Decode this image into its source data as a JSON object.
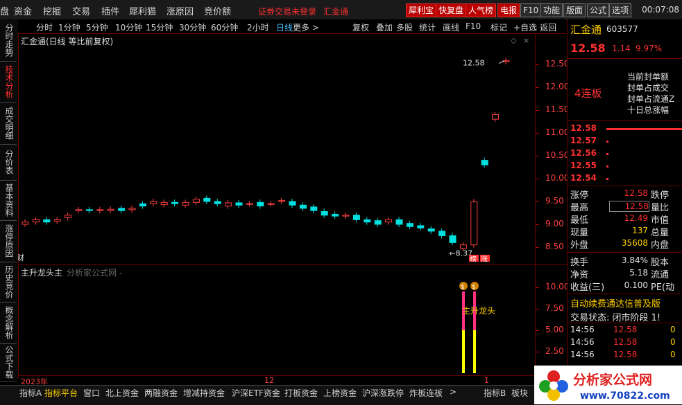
{
  "menu": {
    "items": [
      "盘",
      "资金",
      "挖掘",
      "交易",
      "插件",
      "犀利猫",
      "涨原因",
      "竞价额"
    ],
    "login_status": "证券交易未登录",
    "stock_link": "汇金通"
  },
  "top_buttons": [
    "犀利宝",
    "快复盘",
    "人气榜",
    "电报",
    "F10",
    "功能",
    "版面",
    "公式",
    "选项"
  ],
  "clock": "00:07:08",
  "periods": [
    "分时",
    "1分钟",
    "5分钟",
    "10分钟",
    "15分钟",
    "30分钟",
    "60分钟",
    "2小时",
    "日线",
    "更多 >"
  ],
  "tools": [
    "复权",
    "叠加",
    "多股",
    "统计",
    "画线",
    "F10",
    "标记",
    "+自选",
    "返回"
  ],
  "left_tabs": [
    "分时走势",
    "技术分析",
    "成交明细",
    "分价表",
    "基本资料",
    "涨停原因",
    "历史竞价",
    "概念解析",
    "公式下载"
  ],
  "chart": {
    "title": "汇金通(日线 等比前复权)",
    "high_label": "12.58",
    "low_label": "8.37",
    "cai": "财",
    "badges": [
      "榜",
      "涨"
    ]
  },
  "indicator": {
    "title": "主升龙头主",
    "subtitle": "分析家公式网 -",
    "label": "主升龙头"
  },
  "xaxis": {
    "start": "2023年",
    "mid": "12",
    "end": "1"
  },
  "bottom_tabs": [
    "指标A",
    "指标平台",
    "窗口",
    "北上资金",
    "两融资金",
    "增减持资金",
    "沪深ETF资金",
    "打板资金",
    "上榜资金",
    "沪深涨跌停",
    "炸板连板",
    ">"
  ],
  "bottom_right": [
    "指标B",
    "板块"
  ],
  "quote": {
    "name": "汇金通",
    "code": "603577",
    "price": "12.58",
    "change": "1.14",
    "pct": "9.97%",
    "board": "4连板",
    "board_info": [
      "当前封单额",
      "封单占成交",
      "封单占流通Z",
      "十日总涨幅"
    ],
    "ladder": [
      "12.58",
      "12.57",
      "12.56",
      "12.55",
      "12.54"
    ],
    "rows": [
      {
        "k": "涨停",
        "v": "12.58",
        "k2": "跌停"
      },
      {
        "k": "最高",
        "v": "12.58",
        "k2": "量比"
      },
      {
        "k": "最低",
        "v": "12.49",
        "k2": "市值"
      },
      {
        "k": "现量",
        "v": "137",
        "k2": "总量"
      },
      {
        "k": "外盘",
        "v": "35608",
        "k2": "内盘"
      }
    ],
    "rows2": [
      {
        "k": "换手",
        "v": "3.84%",
        "k2": "股本"
      },
      {
        "k": "净资",
        "v": "5.18",
        "k2": "流通"
      },
      {
        "k": "收益(三)",
        "v": "0.100",
        "k2": "PE(动"
      }
    ],
    "banner": "自动续费通达信普及版",
    "trade_state": "交易状态: 闭市阶段 1!",
    "ticks": [
      {
        "t": "14:56",
        "p": "12.58",
        "v": "0"
      },
      {
        "t": "14:56",
        "p": "12.58",
        "v": "0"
      },
      {
        "t": "14:56",
        "p": "12.58",
        "v": "0"
      }
    ]
  },
  "y_main": [
    "12.50",
    "12.00",
    "11.50",
    "11.00",
    "10.50",
    "10.00",
    "9.50",
    "9.00",
    "8.50"
  ],
  "y_ind": [
    "10.00",
    "7.50",
    "5.00",
    "2.50"
  ],
  "logo": {
    "text": "分析家公式网",
    "url": "www.70822.com"
  }
}
